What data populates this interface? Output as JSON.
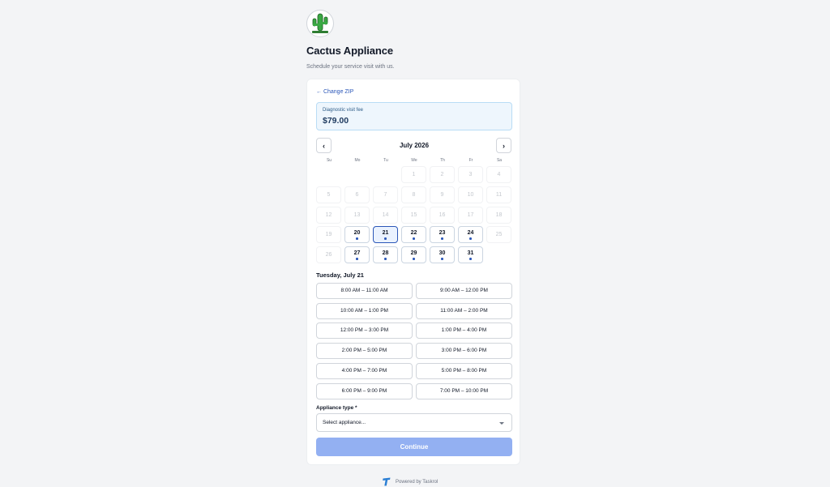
{
  "business": {
    "name": "Cactus Appliance",
    "tagline": "Schedule your service visit with us.",
    "logo_text": "CACTUS APPLIANCE"
  },
  "booking": {
    "change_zip": "← Change ZIP",
    "fee_label": "Diagnostic visit fee",
    "fee_amount": "$79.00"
  },
  "calendar": {
    "month_label": "July 2026",
    "prev_label": "‹",
    "next_label": "›",
    "weekdays": [
      "Su",
      "Mo",
      "Tu",
      "We",
      "Th",
      "Fr",
      "Sa"
    ],
    "first_weekday_index": 3,
    "days_in_month": 31,
    "available_days": [
      20,
      21,
      22,
      23,
      24,
      27,
      28,
      29,
      30,
      31
    ],
    "selected_day": 21
  },
  "selected_date_label": "Tuesday, July 21",
  "time_slots": [
    "8:00 AM – 11:00 AM",
    "9:00 AM – 12:00 PM",
    "10:00 AM – 1:00 PM",
    "11:00 AM – 2:00 PM",
    "12:00 PM – 3:00 PM",
    "1:00 PM – 4:00 PM",
    "2:00 PM – 5:00 PM",
    "3:00 PM – 6:00 PM",
    "4:00 PM – 7:00 PM",
    "5:00 PM – 8:00 PM",
    "6:00 PM – 9:00 PM",
    "7:00 PM – 10:00 PM"
  ],
  "appliance": {
    "label": "Appliance type *",
    "placeholder": "Select appliance..."
  },
  "continue_label": "Continue",
  "footer": {
    "powered_by": "Powered by Taskrol",
    "icon": "taskrol-logo-icon"
  },
  "colors": {
    "accent": "#2b57b8",
    "continue_disabled": "#93b0f2",
    "fee_bg": "#eef6fd"
  }
}
